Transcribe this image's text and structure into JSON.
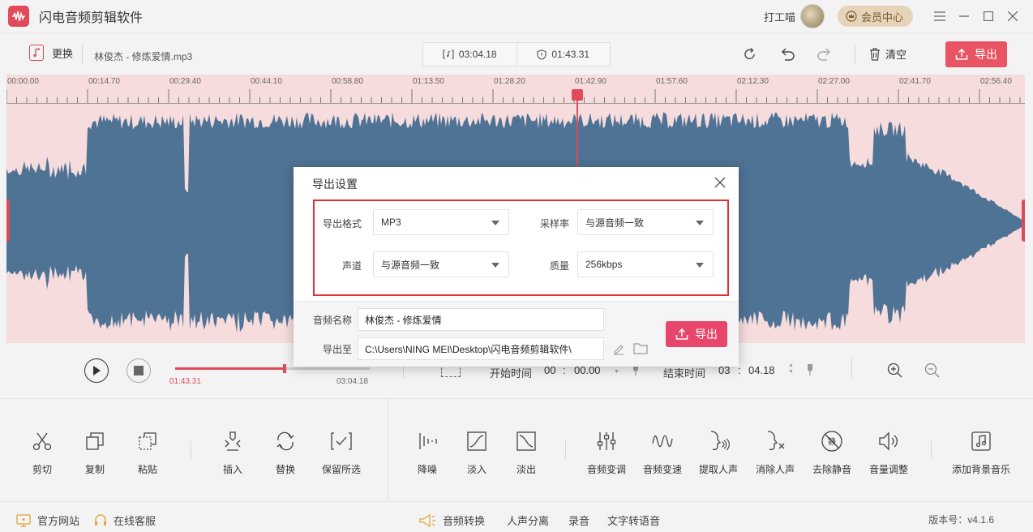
{
  "app": {
    "title": "闪电音频剪辑软件",
    "username": "打工喵",
    "vip_label": "会员中心"
  },
  "toolbar": {
    "change_label": "更换",
    "filename": "林俊杰 - 修炼爱情.mp3",
    "total_time": "03:04.18",
    "selected_time": "01:43.31",
    "clear_label": "清空",
    "export_label": "导出"
  },
  "ruler": {
    "labels": [
      "00:00.00",
      "00:14.70",
      "00:29.40",
      "00:44.10",
      "00:58.80",
      "01:13.50",
      "01:28.20",
      "01:42.90",
      "01:57.60",
      "02:12.30",
      "02:27.00",
      "02:41.70",
      "02:56.40"
    ]
  },
  "playback": {
    "current_time": "01:43.31",
    "total_time": "03:04.18",
    "progress": 0.561,
    "start_label": "开始时间",
    "start_min": "00",
    "start_sec": "00.00",
    "end_label": "结束时间",
    "end_min": "03",
    "end_sec": "04.18"
  },
  "tools": {
    "cut": "剪切",
    "copy": "复制",
    "paste": "粘贴",
    "insert": "插入",
    "replace": "替换",
    "keep_selected": "保留所选",
    "denoise": "降噪",
    "fade_in": "淡入",
    "fade_out": "淡出",
    "pitch": "音频变调",
    "speed": "音频变速",
    "extract_vocal": "提取人声",
    "remove_vocal": "消除人声",
    "remove_silence": "去除静音",
    "volume": "音量调整",
    "add_bgm": "添加背景音乐"
  },
  "statusbar": {
    "website": "官方网站",
    "support": "在线客服",
    "convert": "音频转换",
    "separate": "人声分离",
    "record": "录音",
    "tts": "文字转语音",
    "version": "版本号：v4.1.6"
  },
  "dialog": {
    "title": "导出设置",
    "format_label": "导出格式",
    "format_value": "MP3",
    "sample_rate_label": "采样率",
    "sample_rate_value": "与源音频一致",
    "channel_label": "声道",
    "channel_value": "与源音频一致",
    "quality_label": "质量",
    "quality_value": "256kbps",
    "name_label": "音频名称",
    "name_value": "林俊杰 - 修炼爱情",
    "path_label": "导出至",
    "path_value": "C:\\Users\\NING MEI\\Desktop\\闪电音频剪辑软件\\",
    "export_label": "导出"
  },
  "colors": {
    "accent": "#e85464",
    "waveform": "#4f7395",
    "wave_bg": "#f6dcdc",
    "highlight_box": "#e53030"
  }
}
